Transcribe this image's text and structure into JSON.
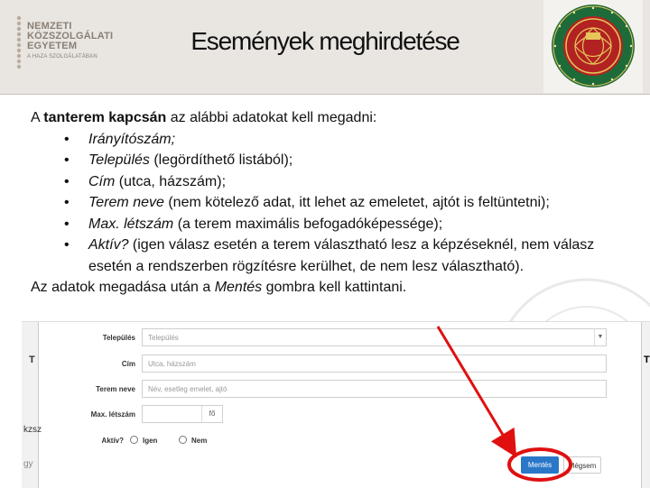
{
  "header": {
    "title": "Események meghirdetése",
    "logo_lines": [
      "NEMZETI",
      "KÖZSZOLGÁLATI",
      "EGYETEM"
    ],
    "logo_tagline": "A HAZA SZOLGÁLATÁBAN",
    "seal_icon": "university-seal-icon"
  },
  "body": {
    "intro_prefix": "A ",
    "intro_bold": "tanterem kapcsán",
    "intro_suffix": " az alábbi adatokat kell megadni:",
    "bullet_char": "•",
    "items": [
      {
        "em": "Irányítószám;",
        "rest": ""
      },
      {
        "em": "Település",
        "rest": " (legördíthető listából);"
      },
      {
        "em": "Cím",
        "rest": " (utca, házszám);"
      },
      {
        "em": "Terem neve",
        "rest": " (nem kötelező adat, itt lehet az emeletet, ajtót is feltüntetni);"
      },
      {
        "em": "Max. létszám",
        "rest": " (a terem maximális befogadóképessége);"
      },
      {
        "em": "Aktív?",
        "rest": " (igen válasz esetén a terem választható lesz a képzéseknél, nem válasz  esetén a rendszerben rögzítésre kerülhet, de nem lesz választható)."
      }
    ],
    "outro_prefix": "Az adatok megadása után a  ",
    "outro_em": "Mentés",
    "outro_suffix": " gombra kell kattintani."
  },
  "form": {
    "left_strip": [
      "T",
      "kzsz",
      "gy"
    ],
    "right_strip": "T",
    "settlement": {
      "label": "Település",
      "placeholder": "Település"
    },
    "address": {
      "label": "Cím",
      "placeholder": "Utca, házszám"
    },
    "room_name": {
      "label": "Terem neve",
      "placeholder": "Név, esetleg emelet, ajtó"
    },
    "capacity": {
      "label": "Max. létszám",
      "unit": "fő"
    },
    "active": {
      "label": "Aktív?",
      "options": [
        "Igen",
        "Nem"
      ]
    },
    "save_label": "Mentés",
    "cancel_label": "Mégsem"
  },
  "colors": {
    "header_bg": "#e9e5e1",
    "seal_green": "#1e6b3a",
    "seal_red": "#b22222",
    "annotation_red": "#e01010",
    "save_blue": "#2a77c7"
  }
}
